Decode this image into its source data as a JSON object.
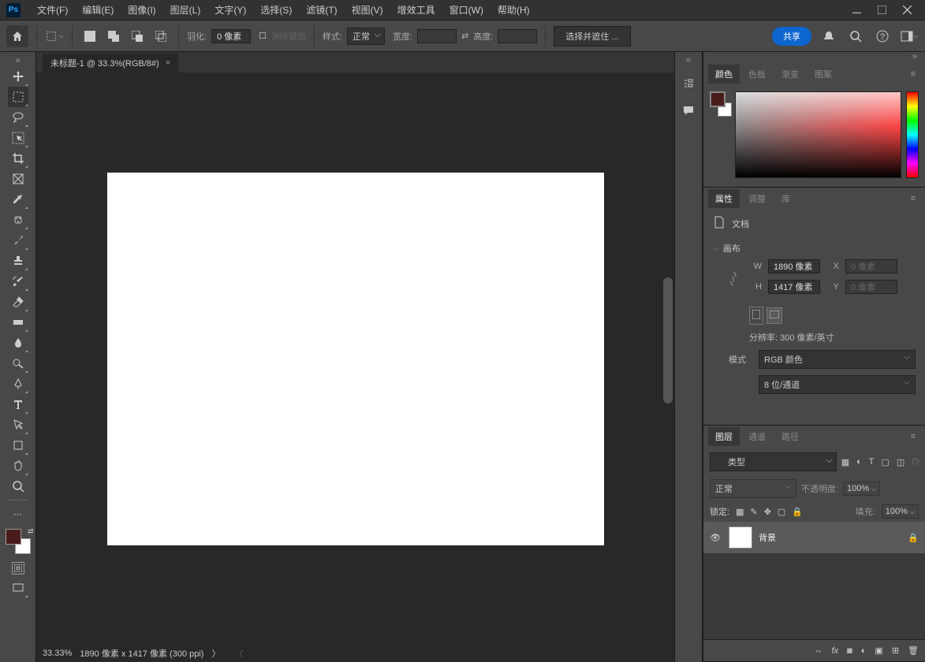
{
  "menu": {
    "file": "文件(F)",
    "edit": "编辑(E)",
    "image": "图像(I)",
    "layer": "图层(L)",
    "type": "文字(Y)",
    "select": "选择(S)",
    "filter": "滤镜(T)",
    "view": "视图(V)",
    "plugins": "增效工具",
    "window": "窗口(W)",
    "help": "帮助(H)"
  },
  "options": {
    "feather_label": "羽化:",
    "feather_value": "0 像素",
    "antialias": "消除锯齿",
    "style_label": "样式:",
    "style_value": "正常",
    "width_label": "宽度:",
    "swap": "⇄",
    "height_label": "高度:",
    "mask": "选择并遮住 ..."
  },
  "share": "共享",
  "doc_tab": "未标题-1 @ 33.3%(RGB/8#)",
  "status": {
    "zoom": "33.33%",
    "dims": "1890 像素 x 1417 像素 (300 ppi)"
  },
  "panels": {
    "color": {
      "tab1": "颜色",
      "tab2": "色板",
      "tab3": "渐变",
      "tab4": "图案"
    },
    "props": {
      "tab1": "属性",
      "tab2": "调整",
      "tab3": "库",
      "doc": "文档",
      "canvas": "画布",
      "w_label": "W",
      "w_val": "1890 像素",
      "x_label": "X",
      "x_val": "0 像素",
      "h_label": "H",
      "h_val": "1417 像素",
      "y_label": "Y",
      "y_val": "0 像素",
      "res": "分辨率: 300 像素/英寸",
      "mode_label": "模式",
      "mode_val": "RGB 颜色",
      "depth_val": "8 位/通道"
    },
    "layers": {
      "tab1": "图层",
      "tab2": "通道",
      "tab3": "路径",
      "kind": "类型",
      "blend": "正常",
      "opacity_label": "不透明度:",
      "opacity_val": "100%",
      "lock_label": "锁定:",
      "fill_label": "填充:",
      "fill_val": "100%",
      "layer_name": "背景"
    }
  }
}
